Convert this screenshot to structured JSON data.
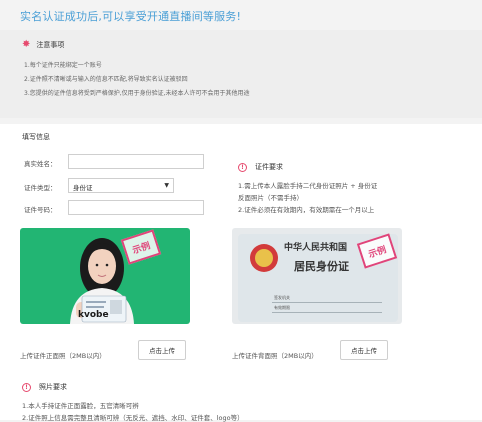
{
  "headline": "实名认证成功后,可以享受开通直播间等服务!",
  "notice": {
    "title": "注意事项",
    "lines": [
      "1.每个证件只能绑定一个账号",
      "2.证件照不清晰或与输入的信息不匹配,将导致实名认证被驳回",
      "3.您提供的证件信息将受到严格保护,仅用于身份验证,未经本人许可不会用于其他用途"
    ]
  },
  "form": {
    "heading": "填写信息",
    "name_label": "真实姓名：",
    "name_value": "",
    "id_type_label": "证件类型：",
    "id_type_value": "身份证",
    "id_number_label": "证件号码：",
    "id_number_value": ""
  },
  "requirements": {
    "title": "证件要求",
    "line1": "1.需上传本人露脸手持二代身份证照片 + 身份证",
    "line2": "反面照片（不需手持）",
    "line3": "2.证件必须在有效期内，有效期需在一个月以上"
  },
  "samples": {
    "stamp": "示例",
    "front_card_brand": "kvobe",
    "back_title": "中华人民共和国",
    "back_subtitle": "居民身份证",
    "back_field1": "签发机关",
    "back_field2": "有效期限"
  },
  "uploads": {
    "front_label": "上传证件正面照（2MB以内）",
    "back_label": "上传证件背面照（2MB以内）",
    "button_label": "点击上传"
  },
  "photo_requirements": {
    "title": "照片要求",
    "line1": "1.本人手持证件正面露脸，五官清晰可辨",
    "line2": "2.证件照上信息需完整且清晰可辨（无反光、遮挡、水印、证件套、logo等）"
  },
  "colors": {
    "accent_blue": "#4a9fd6",
    "accent_pink": "#e64a6e",
    "sample_green": "#22b573"
  },
  "icons": {
    "notice": "gear-icon",
    "info": "info-circle-icon",
    "select": "caret-down-icon"
  }
}
